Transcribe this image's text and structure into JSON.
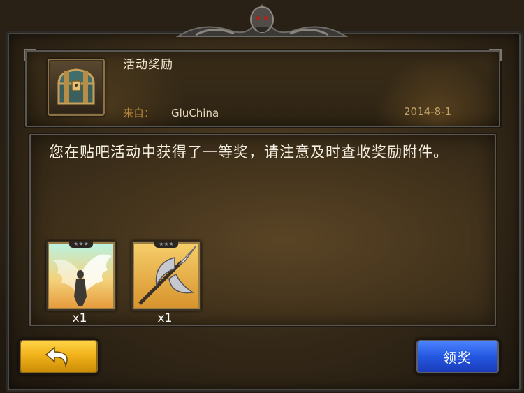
{
  "mail": {
    "title": "活动奖励",
    "from_label": "来自：",
    "sender": "GluChina",
    "date": "2014-8-1",
    "message": "您在贴吧活动中获得了一等奖，请注意及时查收奖励附件。"
  },
  "attachments": [
    {
      "name": "angel-wings-item",
      "quantity": "x1",
      "stars": "★★★"
    },
    {
      "name": "spear-item",
      "quantity": "x1",
      "stars": "★★★"
    }
  ],
  "buttons": {
    "back_icon": "back-arrow-icon",
    "claim_label": "领奖"
  },
  "colors": {
    "back_button": "#f1b21a",
    "claim_button": "#2357e0",
    "date_text": "#c1a269",
    "from_label_text": "#b9893c"
  }
}
